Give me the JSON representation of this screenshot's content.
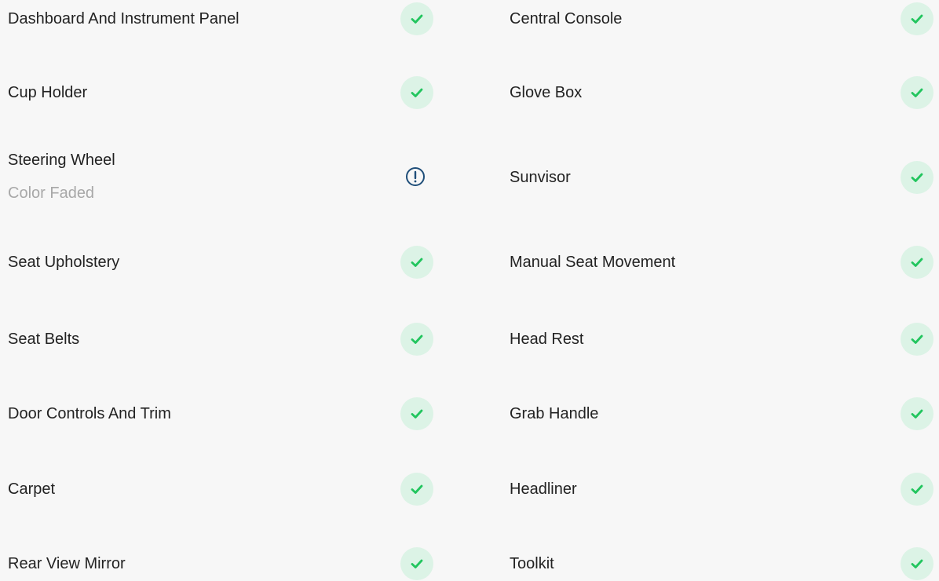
{
  "colors": {
    "ok_icon": "#22c55e",
    "ok_bg": "#dcf3e6",
    "warn_icon": "#1f4e79",
    "text": "#222222",
    "subtext": "#a8a8a8"
  },
  "items": [
    {
      "label": "Dashboard And Instrument Panel",
      "status": "ok",
      "icon": "check-icon"
    },
    {
      "label": "Central Console",
      "status": "ok",
      "icon": "check-icon"
    },
    {
      "label": "Cup Holder",
      "status": "ok",
      "icon": "check-icon"
    },
    {
      "label": "Glove Box",
      "status": "ok",
      "icon": "check-icon"
    },
    {
      "label": "Steering Wheel",
      "sublabel": "Color Faded",
      "status": "warn",
      "icon": "exclamation-icon"
    },
    {
      "label": "Sunvisor",
      "status": "ok",
      "icon": "check-icon"
    },
    {
      "label": "Seat Upholstery",
      "status": "ok",
      "icon": "check-icon"
    },
    {
      "label": "Manual Seat Movement",
      "status": "ok",
      "icon": "check-icon"
    },
    {
      "label": "Seat Belts",
      "status": "ok",
      "icon": "check-icon"
    },
    {
      "label": "Head Rest",
      "status": "ok",
      "icon": "check-icon"
    },
    {
      "label": "Door Controls And Trim",
      "status": "ok",
      "icon": "check-icon"
    },
    {
      "label": "Grab Handle",
      "status": "ok",
      "icon": "check-icon"
    },
    {
      "label": "Carpet",
      "status": "ok",
      "icon": "check-icon"
    },
    {
      "label": "Headliner",
      "status": "ok",
      "icon": "check-icon"
    },
    {
      "label": "Rear View Mirror",
      "status": "ok",
      "icon": "check-icon"
    },
    {
      "label": "Toolkit",
      "status": "ok",
      "icon": "check-icon"
    }
  ]
}
